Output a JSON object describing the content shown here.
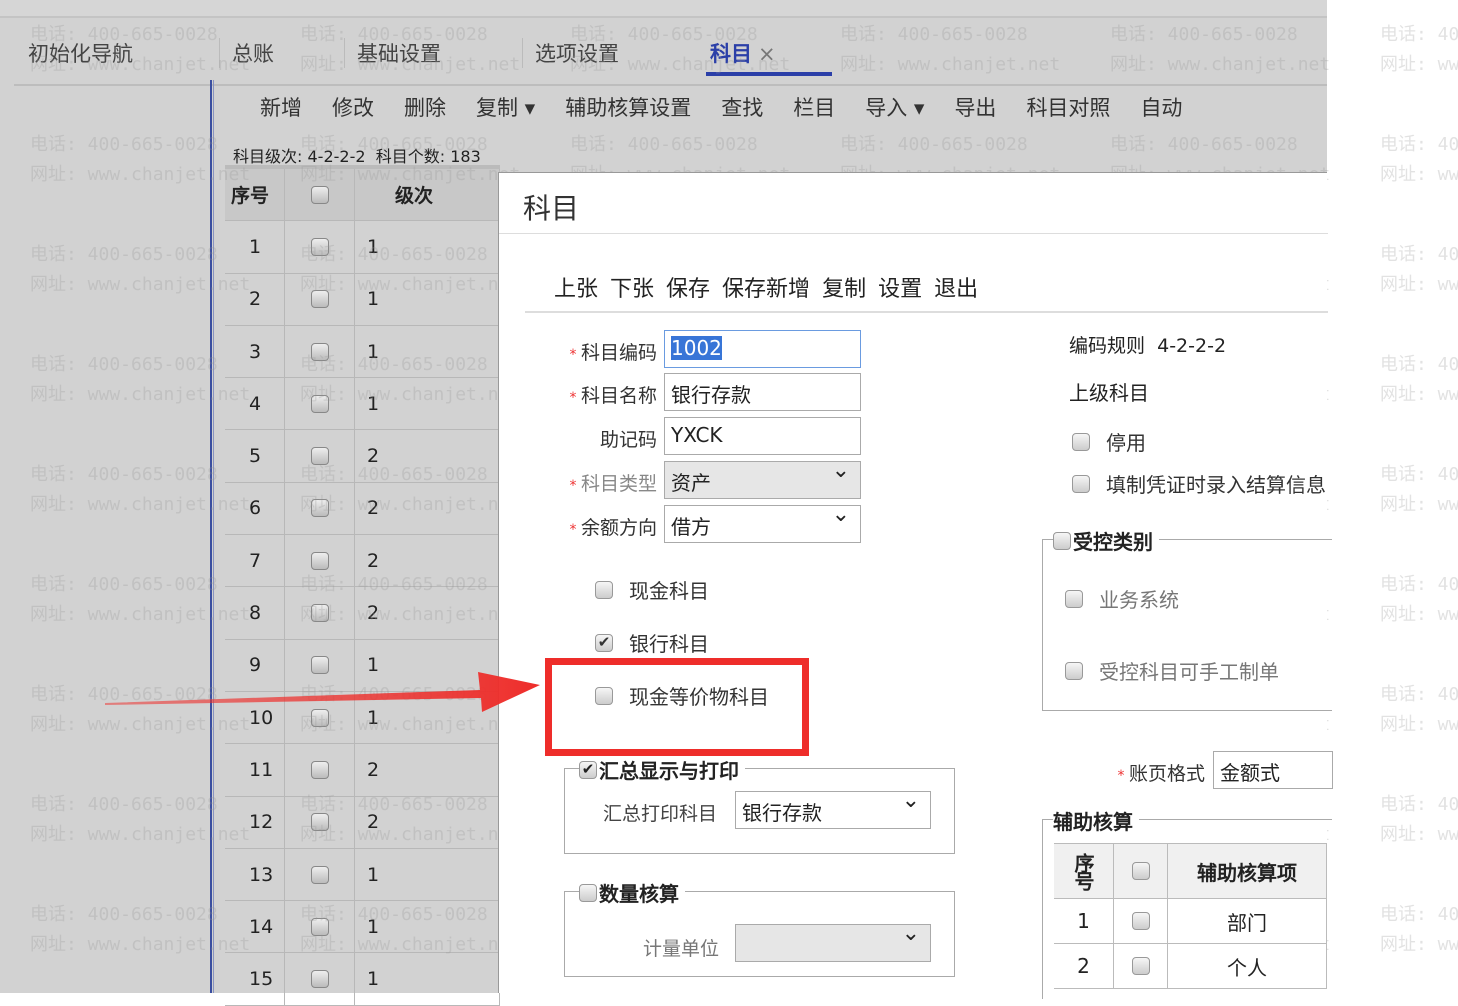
{
  "tabs": [
    {
      "label": "初始化导航"
    },
    {
      "label": "总账"
    },
    {
      "label": "基础设置"
    },
    {
      "label": "选项设置"
    },
    {
      "label": "科目",
      "close": "×"
    }
  ],
  "toolbar": [
    "新增",
    "修改",
    "删除",
    "复制 ▾",
    "辅助核算设置",
    "查找",
    "栏目",
    "导入 ▾",
    "导出",
    "科目对照",
    "自动"
  ],
  "level_info": {
    "label": "科目级次:",
    "value": "4-2-2-2",
    "count_label": "科目个数:",
    "count": "183"
  },
  "grid": {
    "headers": [
      "序号",
      "",
      "级次"
    ],
    "rows": [
      [
        "1",
        "1"
      ],
      [
        "2",
        "1"
      ],
      [
        "3",
        "1"
      ],
      [
        "4",
        "1"
      ],
      [
        "5",
        "2"
      ],
      [
        "6",
        "2"
      ],
      [
        "7",
        "2"
      ],
      [
        "8",
        "2"
      ],
      [
        "9",
        "1"
      ],
      [
        "10",
        "1"
      ],
      [
        "11",
        "2"
      ],
      [
        "12",
        "2"
      ],
      [
        "13",
        "1"
      ],
      [
        "14",
        "1"
      ],
      [
        "15",
        "1"
      ]
    ]
  },
  "dialog": {
    "title": "科目",
    "tools": [
      "上张",
      "下张",
      "保存",
      "保存新增",
      "复制",
      "设置",
      "退出"
    ],
    "code_label": "科目编码",
    "code": "1002",
    "name_label": "科目名称",
    "name": "银行存款",
    "mnemonic_label": "助记码",
    "mnemonic": "YXCK",
    "type_label": "科目类型",
    "type": "资产",
    "direction_label": "余额方向",
    "direction": "借方",
    "cash": "现金科目",
    "bank": "银行科目",
    "cash_equiv": "现金等价物科目",
    "code_rule_label": "编码规则",
    "code_rule": "4-2-2-2",
    "parent_label": "上级科目",
    "disabled": "停用",
    "settle_info": "填制凭证时录入结算信息",
    "controlled": "受控类别",
    "biz_system": "业务系统",
    "manual": "受控科目可手工制单",
    "summary": "汇总显示与打印",
    "summary_subject_label": "汇总打印科目",
    "summary_subject": "银行存款",
    "quantity": "数量核算",
    "unit_label": "计量单位",
    "ledger_label": "账页格式",
    "ledger": "金额式",
    "aux": "辅助核算",
    "aux_headers": [
      "序号",
      "",
      "辅助核算项"
    ],
    "aux_rows": [
      [
        "1",
        "部门"
      ],
      [
        "2",
        "个人"
      ]
    ]
  },
  "watermark": {
    "phone": "电话: 400-665-0028",
    "site": "网址: www.chanjet.net"
  },
  "colors": {
    "accent": "#2b3fa8",
    "highlight": "#ee2d2a"
  }
}
